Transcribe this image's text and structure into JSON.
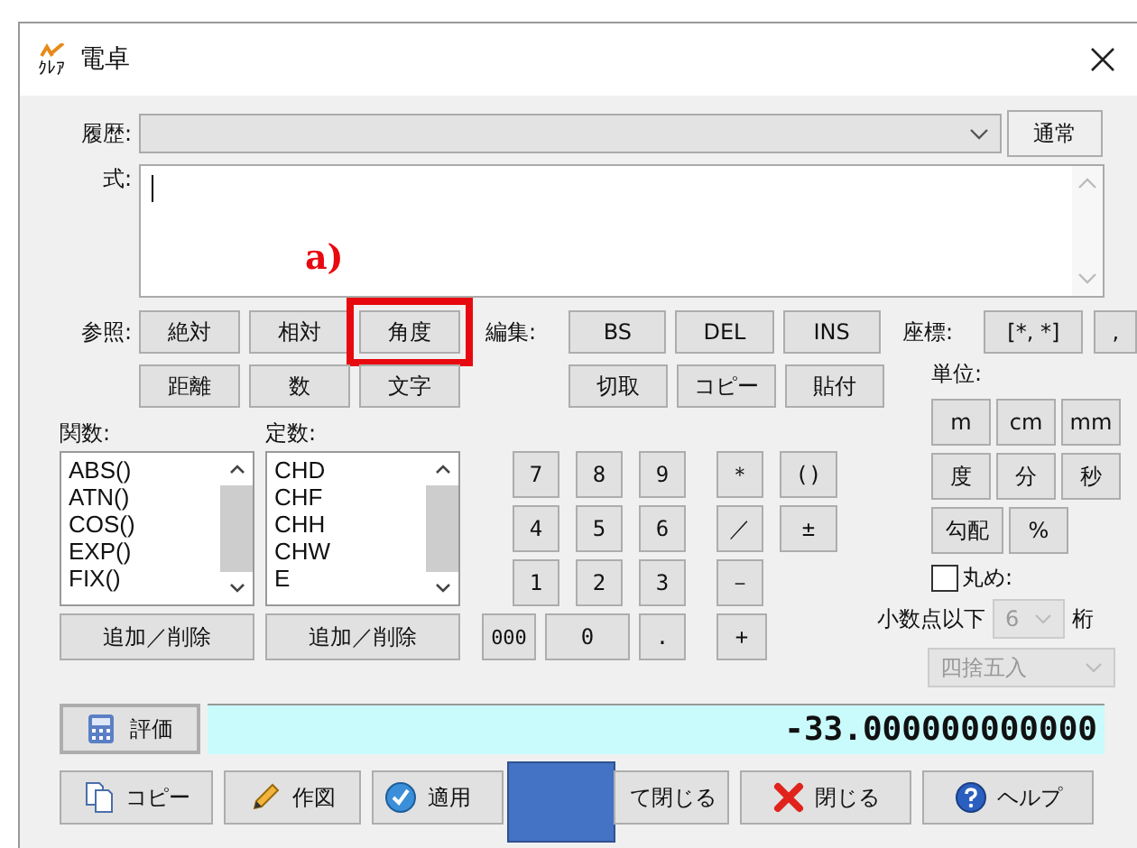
{
  "window": {
    "app_icon_text": "ｸﾚｱ",
    "title": "電卓"
  },
  "history": {
    "label": "履歴:",
    "mode_button": "通常"
  },
  "expression": {
    "label": "式:"
  },
  "annotation": {
    "label": "a)"
  },
  "reference": {
    "label": "参照:",
    "buttons": [
      {
        "label": "絶対",
        "highlighted": false
      },
      {
        "label": "相対",
        "highlighted": false
      },
      {
        "label": "角度",
        "highlighted": true
      },
      {
        "label": "距離",
        "highlighted": false
      },
      {
        "label": "数",
        "highlighted": false
      },
      {
        "label": "文字",
        "highlighted": false
      }
    ]
  },
  "edit": {
    "label": "編集:",
    "buttons": [
      "BS",
      "DEL",
      "INS",
      "切取",
      "コピー",
      "貼付"
    ]
  },
  "coordinates": {
    "label": "座標:",
    "buttons": [
      "[*, *]",
      ","
    ]
  },
  "units": {
    "label": "単位:",
    "rows": [
      [
        "m",
        "cm",
        "mm"
      ],
      [
        "度",
        "分",
        "秒"
      ],
      [
        "勾配",
        "%"
      ]
    ]
  },
  "functions": {
    "label": "関数:",
    "items": [
      "ABS()",
      "ATN()",
      "COS()",
      "EXP()",
      "FIX()"
    ],
    "button": "追加／削除"
  },
  "constants": {
    "label": "定数:",
    "items": [
      "CHD",
      "CHF",
      "CHH",
      "CHW",
      "E"
    ],
    "button": "追加／削除"
  },
  "keypad": [
    [
      "7",
      "8",
      "9",
      "＊",
      "()"
    ],
    [
      "4",
      "5",
      "6",
      "／",
      "±"
    ],
    [
      "1",
      "2",
      "3",
      "－"
    ],
    [
      "000",
      "0",
      ".",
      "+"
    ]
  ],
  "rounding": {
    "label": "丸め:",
    "checked": false,
    "digits_label": "小数点以下",
    "digits": "6",
    "digits_unit": "桁",
    "method": "四捨五入",
    "disabled": true
  },
  "evaluate": {
    "button": "評価",
    "result": "-33.000000000000"
  },
  "actions": [
    {
      "label": "コピー",
      "kind": "copy"
    },
    {
      "label": "作図",
      "kind": "pencil"
    },
    {
      "label": "適用",
      "kind": "check"
    },
    {
      "label": "て閉じる",
      "kind": "none"
    },
    {
      "label": "閉じる",
      "kind": "cross"
    },
    {
      "label": "ヘルプ",
      "kind": "help"
    }
  ]
}
